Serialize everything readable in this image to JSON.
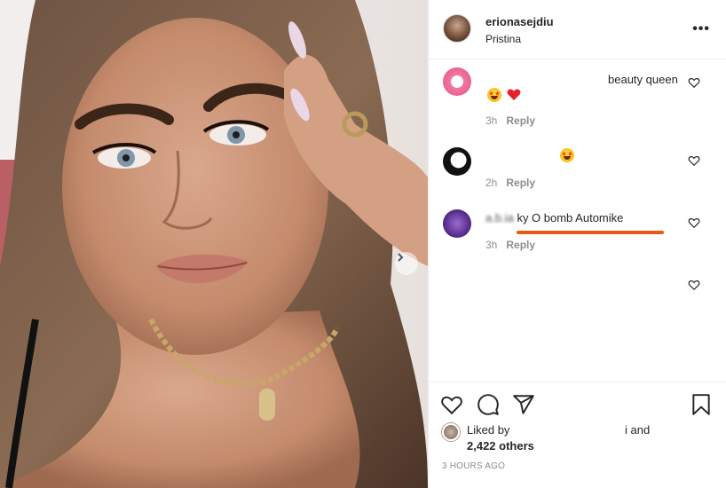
{
  "post": {
    "username": "erionasejdiu",
    "location": "Pristina",
    "more_label": "•••"
  },
  "comments": [
    {
      "text": "beauty queen",
      "time": "3h",
      "reply": "Reply"
    },
    {
      "text": "",
      "time": "2h",
      "reply": "Reply"
    },
    {
      "text_blurred": "a.b.ia",
      "text": "ky O bomb Automike",
      "time": "3h",
      "reply": "Reply"
    }
  ],
  "likes": {
    "liked_by": "Liked by",
    "and": "i and",
    "others": "2,422 others"
  },
  "time_ago": "3 HOURS AGO",
  "colors": {
    "underline": "#e85a16",
    "heart": "#ed4956",
    "meta": "#8e8e8e"
  },
  "icons": [
    "heart-icon",
    "comment-icon",
    "share-icon",
    "bookmark-icon",
    "chevron-right-icon",
    "more-icon"
  ]
}
